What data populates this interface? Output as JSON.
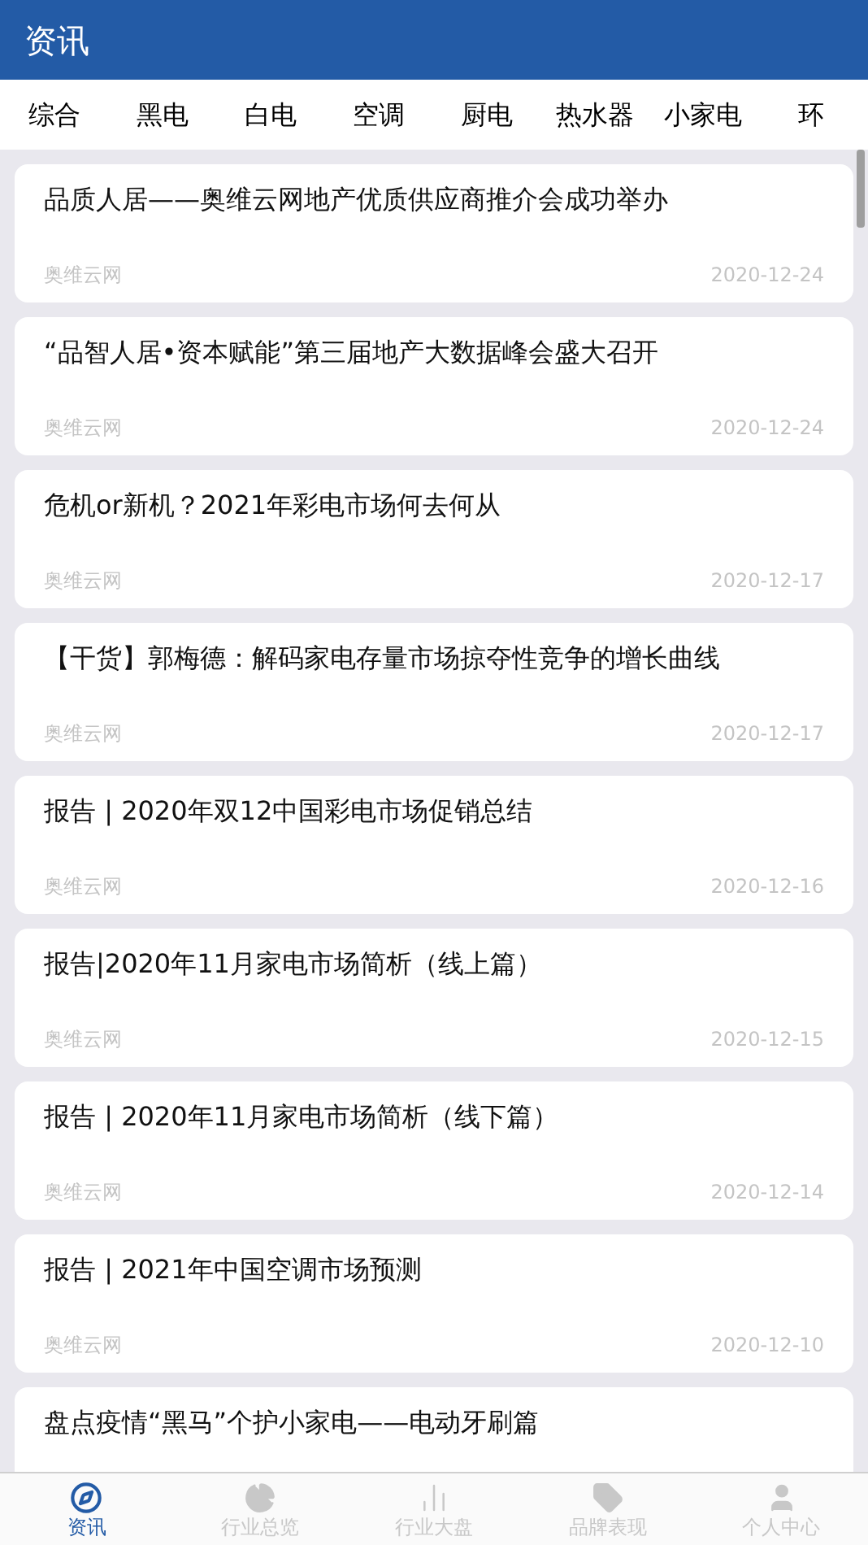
{
  "header": {
    "title": "资讯"
  },
  "categories": [
    {
      "label": "综合"
    },
    {
      "label": "黑电"
    },
    {
      "label": "白电"
    },
    {
      "label": "空调"
    },
    {
      "label": "厨电"
    },
    {
      "label": "热水器"
    },
    {
      "label": "小家电"
    },
    {
      "label": "环"
    }
  ],
  "articles": [
    {
      "title": "品质人居——奥维云网地产优质供应商推介会成功举办",
      "source": "奥维云网",
      "date": "2020-12-24"
    },
    {
      "title": "“品智人居•资本赋能”第三届地产大数据峰会盛大召开",
      "source": "奥维云网",
      "date": "2020-12-24"
    },
    {
      "title": "危机or新机？2021年彩电市场何去何从",
      "source": "奥维云网",
      "date": "2020-12-17"
    },
    {
      "title": "【干货】郭梅德：解码家电存量市场掠夺性竞争的增长曲线",
      "source": "奥维云网",
      "date": "2020-12-17"
    },
    {
      "title": "报告 | 2020年双12中国彩电市场促销总结",
      "source": "奥维云网",
      "date": "2020-12-16"
    },
    {
      "title": "报告|2020年11月家电市场简析（线上篇）",
      "source": "奥维云网",
      "date": "2020-12-15"
    },
    {
      "title": "报告 | 2020年11月家电市场简析（线下篇）",
      "source": "奥维云网",
      "date": "2020-12-14"
    },
    {
      "title": "报告 | 2021年中国空调市场预测",
      "source": "奥维云网",
      "date": "2020-12-10"
    },
    {
      "title": "盘点疫情“黑马”个护小家电——电动牙刷篇"
    }
  ],
  "bottom_nav": [
    {
      "kind": "compass",
      "label": "资讯",
      "selected": true
    },
    {
      "kind": "pie",
      "label": "行业总览",
      "selected": false
    },
    {
      "kind": "bars",
      "label": "行业大盘",
      "selected": false
    },
    {
      "kind": "tag",
      "label": "品牌表现",
      "selected": false
    },
    {
      "kind": "user",
      "label": "个人中心",
      "selected": false
    }
  ]
}
